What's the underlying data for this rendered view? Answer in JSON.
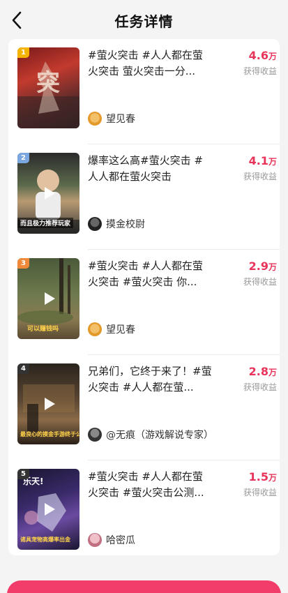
{
  "header": {
    "title": "任务详情"
  },
  "earn_label": "获得收益",
  "items": [
    {
      "rank": "1",
      "description": "#萤火突击 #人人都在萤火突击 萤火突击一分...",
      "author": "望见春",
      "amount": "4.6",
      "unit": "万",
      "thumb_caption": ""
    },
    {
      "rank": "2",
      "description": "爆率这么高#萤火突击 #人人都在萤火突击",
      "author": "摸金校尉",
      "amount": "4.1",
      "unit": "万",
      "thumb_caption": "而且极力推荐玩家"
    },
    {
      "rank": "3",
      "description": "#萤火突击 #人人都在萤火突击 #萤火突击 你...",
      "author": "望见春",
      "amount": "2.9",
      "unit": "万",
      "thumb_caption": "可以赚钱吗"
    },
    {
      "rank": "4",
      "description": "兄弟们，它终于来了！#萤火突击 #人人都在萤...",
      "author": "@无痕（游戏解说专家）",
      "amount": "2.8",
      "unit": "万",
      "thumb_caption": "最良心的摸金手游终于公测"
    },
    {
      "rank": "5",
      "description": "#萤火突击 #人人都在萤火突击 #萤火突击公测...",
      "author": "哈密瓜",
      "amount": "1.5",
      "unit": "万",
      "thumb_caption": "诸具宠物高爆率出金",
      "thumb_top_text": "乐天!"
    }
  ],
  "colors": {
    "accent": "#e8335a",
    "rank_1": "#f5b400",
    "rank_2": "#7aa7e0",
    "rank_3": "#f08a3a",
    "rank_other": "#333333"
  }
}
